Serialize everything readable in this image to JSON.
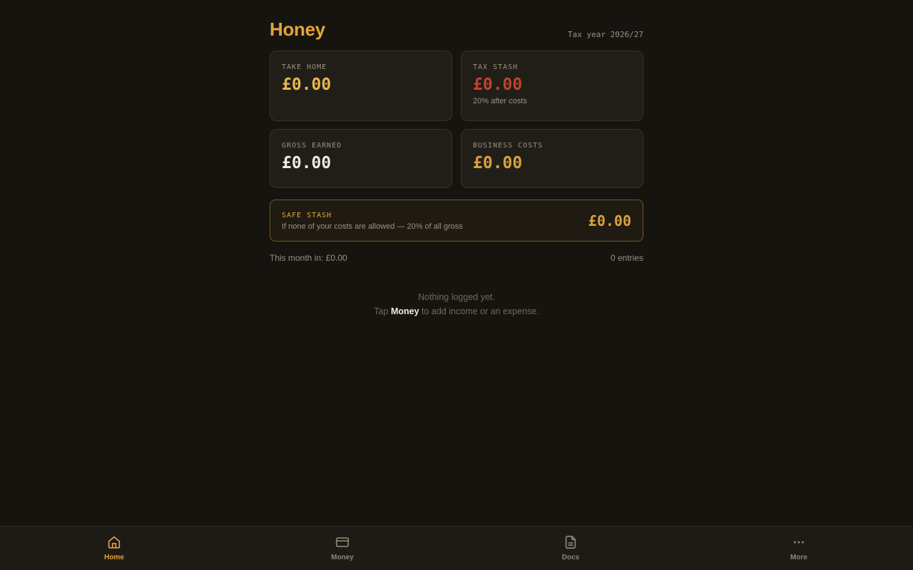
{
  "app": {
    "title": "Honey",
    "tax_year": "Tax year 2026/27"
  },
  "cards": {
    "take_home": {
      "label": "TAKE HOME",
      "value": "£0.00"
    },
    "tax_stash": {
      "label": "TAX STASH",
      "value": "£0.00",
      "subtext": "20% after costs"
    },
    "gross_earned": {
      "label": "GROSS EARNED",
      "value": "£0.00"
    },
    "business_costs": {
      "label": "BUSINESS COSTS",
      "value": "£0.00"
    }
  },
  "safe_stash": {
    "label": "SAFE STASH",
    "description": "If none of your costs are allowed — 20% of all gross",
    "value": "£0.00"
  },
  "summary": {
    "month_in": "This month in: £0.00",
    "entries": "0 entries"
  },
  "empty_state": {
    "line1": "Nothing logged yet.",
    "line2_prefix": "Tap ",
    "line2_emphasis": "Money",
    "line2_suffix": " to add income or an expense."
  },
  "nav": {
    "items": [
      {
        "label": "Home",
        "icon": "home-icon",
        "active": true
      },
      {
        "label": "Money",
        "icon": "card-icon",
        "active": false
      },
      {
        "label": "Docs",
        "icon": "document-icon",
        "active": false
      },
      {
        "label": "More",
        "icon": "more-icon",
        "active": false
      }
    ]
  },
  "colors": {
    "background": "#16140f",
    "accent": "#e3a43c",
    "tax_red": "#c2412d",
    "card_bg": "#211e18"
  }
}
